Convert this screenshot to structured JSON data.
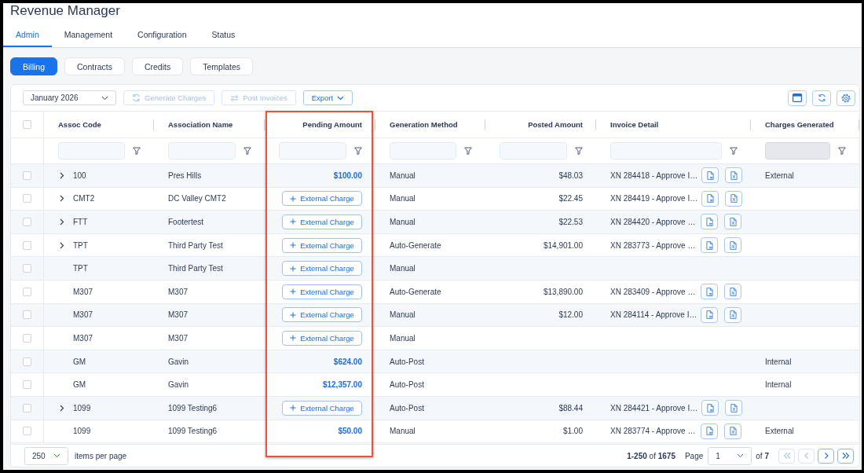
{
  "app": {
    "title": "Revenue Manager"
  },
  "tabs": [
    {
      "label": "Admin",
      "selected": true
    },
    {
      "label": "Management",
      "selected": false
    },
    {
      "label": "Configuration",
      "selected": false
    },
    {
      "label": "Status",
      "selected": false
    }
  ],
  "subtabs": [
    {
      "label": "Billing",
      "selected": true
    },
    {
      "label": "Contracts",
      "selected": false
    },
    {
      "label": "Credits",
      "selected": false
    },
    {
      "label": "Templates",
      "selected": false
    }
  ],
  "toolbar": {
    "period": "January 2026",
    "actions": [
      {
        "label": "Generate Charges",
        "kind": "refresh",
        "disabled": true
      },
      {
        "label": "Post Invoices",
        "kind": "swap",
        "disabled": true
      },
      {
        "label": "Export",
        "kind": "menu",
        "disabled": false
      }
    ]
  },
  "table": {
    "select_all": {
      "checked": false
    },
    "columns": [
      {
        "label": "Assoc Code",
        "kind": "text",
        "highlighted": false,
        "filter_disabled": false
      },
      {
        "label": "Association Name",
        "kind": "text",
        "highlighted": false,
        "filter_disabled": false
      },
      {
        "label": "Pending Amount",
        "kind": "amount",
        "highlighted": true,
        "filter_disabled": false
      },
      {
        "label": "Generation Method",
        "kind": "text",
        "highlighted": false,
        "filter_disabled": false
      },
      {
        "label": "Posted Amount",
        "kind": "amount",
        "highlighted": false,
        "filter_disabled": false
      },
      {
        "label": "Invoice Detail",
        "kind": "text",
        "highlighted": false,
        "filter_disabled": false
      },
      {
        "label": "Charges Generated",
        "kind": "text",
        "highlighted": false,
        "filter_disabled": true
      }
    ],
    "rows": [
      {
        "checked": false,
        "expandable": true,
        "code": "100",
        "name": "Pres Hills",
        "pending": {
          "kind": "amount",
          "text": "$100.00"
        },
        "method": "Manual",
        "posted": "$48.03",
        "invoice": "XN 284418 - Approve I…",
        "charges": "External"
      },
      {
        "checked": false,
        "expandable": true,
        "code": "CMT2",
        "name": "DC Valley CMT2",
        "pending": {
          "kind": "button",
          "text": "External Charge"
        },
        "method": "Manual",
        "posted": "$22.45",
        "invoice": "XN 284419 - Approve I…"
      },
      {
        "checked": false,
        "expandable": true,
        "code": "FTT",
        "name": "Footertest",
        "pending": {
          "kind": "button",
          "text": "External Charge"
        },
        "method": "Manual",
        "posted": "$22.53",
        "invoice": "XN 284420 - Approve …"
      },
      {
        "checked": false,
        "expandable": true,
        "code": "TPT",
        "name": "Third Party Test",
        "pending": {
          "kind": "button",
          "text": "External Charge"
        },
        "method": "Auto-Generate",
        "posted": "$14,901.00",
        "invoice": "XN 283773 - Approve …"
      },
      {
        "checked": false,
        "expandable": false,
        "code": "TPT",
        "name": "Third Party Test",
        "pending": {
          "kind": "button",
          "text": "External Charge"
        },
        "method": "Manual"
      },
      {
        "checked": false,
        "expandable": false,
        "code": "M307",
        "name": "M307",
        "pending": {
          "kind": "button",
          "text": "External Charge"
        },
        "method": "Auto-Generate",
        "posted": "$13,890.00",
        "invoice": "XN 283409 - Approve …"
      },
      {
        "checked": false,
        "expandable": false,
        "code": "M307",
        "name": "M307",
        "pending": {
          "kind": "button",
          "text": "External Charge"
        },
        "method": "Manual",
        "posted": "$12.00",
        "invoice": "XN 284114 - Approve I…"
      },
      {
        "checked": false,
        "expandable": false,
        "code": "M307",
        "name": "M307",
        "pending": {
          "kind": "button",
          "text": "External Charge"
        },
        "method": "Manual"
      },
      {
        "checked": false,
        "expandable": false,
        "code": "GM",
        "name": "Gavin",
        "pending": {
          "kind": "amount",
          "text": "$624.00"
        },
        "method": "Auto-Post",
        "charges": "Internal"
      },
      {
        "checked": false,
        "expandable": false,
        "code": "GM",
        "name": "Gavin",
        "pending": {
          "kind": "amount",
          "text": "$12,357.00"
        },
        "method": "Auto-Post",
        "charges": "Internal"
      },
      {
        "checked": false,
        "expandable": true,
        "code": "1099",
        "name": "1099 Testing6",
        "pending": {
          "kind": "button",
          "text": "External Charge"
        },
        "method": "Auto-Post",
        "posted": "$88.44",
        "invoice": "XN 284421 - Approve I…"
      },
      {
        "checked": false,
        "expandable": false,
        "code": "1099",
        "name": "1099 Testing6",
        "pending": {
          "kind": "amount",
          "text": "$50.00"
        },
        "method": "Manual",
        "posted": "$1.00",
        "invoice": "XN 283774 - Approve …",
        "charges": "External"
      }
    ]
  },
  "footer": {
    "page_size": "250",
    "page_size_label": "items per page",
    "range": "**1-250** of **1675**",
    "page_label": "Page",
    "page": "1",
    "page_count": "of **7**",
    "nav": [
      {
        "kind": "first",
        "disabled": true
      },
      {
        "kind": "prev",
        "disabled": true
      },
      {
        "kind": "next",
        "disabled": false
      },
      {
        "kind": "last",
        "disabled": false
      }
    ]
  }
}
